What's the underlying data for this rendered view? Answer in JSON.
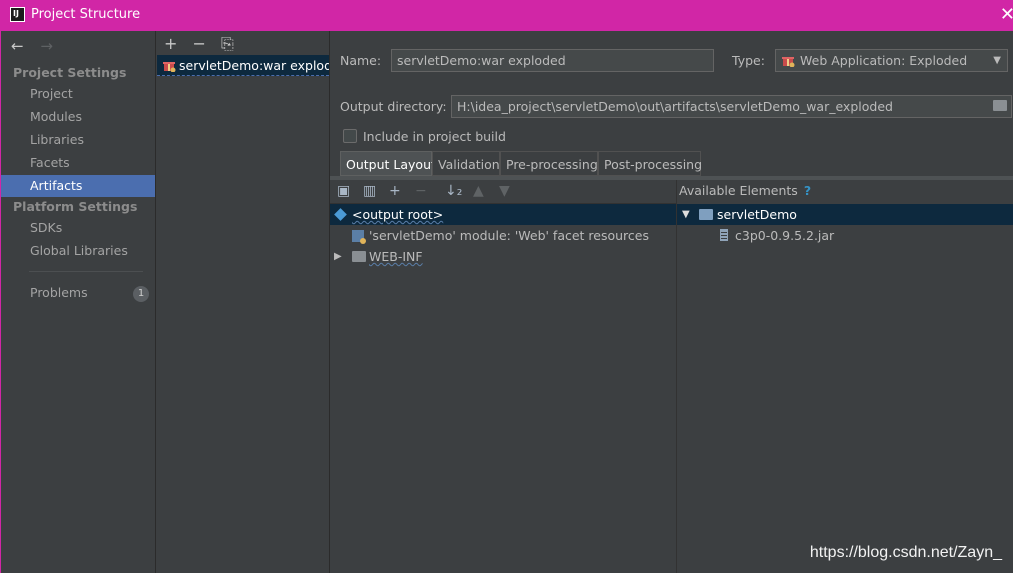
{
  "window": {
    "title": "Project Structure",
    "logo_text": "IJ",
    "close_glyph": "✕"
  },
  "nav": {
    "back_glyph": "←",
    "forward_glyph": "→",
    "project_settings_header": "Project Settings",
    "project_settings": [
      "Project",
      "Modules",
      "Libraries",
      "Facets",
      "Artifacts"
    ],
    "selected": "Artifacts",
    "platform_settings_header": "Platform Settings",
    "platform_settings": [
      "SDKs",
      "Global Libraries"
    ],
    "problems_label": "Problems",
    "problems_count": "1"
  },
  "artifacts": {
    "toolbar": {
      "add": "+",
      "remove": "−",
      "copy": "⎘"
    },
    "items": [
      "servletDemo:war exploded"
    ]
  },
  "form": {
    "name_label": "Name:",
    "name_value": "servletDemo:war exploded",
    "type_label": "Type:",
    "type_value": "Web Application: Exploded",
    "output_dir_label": "Output directory:",
    "output_dir_value": "H:\\idea_project\\servletDemo\\out\\artifacts\\servletDemo_war_exploded",
    "include_label": "Include in project build",
    "include_checked": false
  },
  "tabs": [
    "Output Layout",
    "Validation",
    "Pre-processing",
    "Post-processing"
  ],
  "active_tab": "Output Layout",
  "layout": {
    "available_elements_label": "Available Elements",
    "help_glyph": "?",
    "tree": [
      {
        "label": "<output root>",
        "icon": "diamond-icon",
        "selected": true
      },
      {
        "label": "'servletDemo' module: 'Web' facet resources",
        "icon": "module-icon"
      },
      {
        "label": "WEB-INF",
        "icon": "folder-icon",
        "collapsed": true
      }
    ],
    "available": [
      {
        "label": "servletDemo",
        "icon": "module-folder-icon",
        "expanded": true
      },
      {
        "label": "c3p0-0.9.5.2.jar",
        "icon": "jar-icon"
      }
    ]
  },
  "watermark": "https://blog.csdn.net/Zayn_"
}
